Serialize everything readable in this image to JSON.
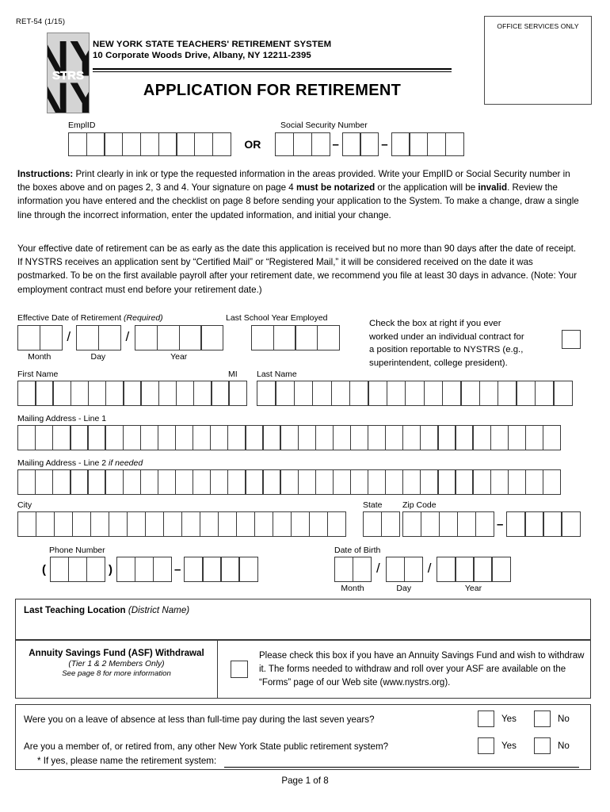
{
  "form": {
    "code": "RET-54  (1/15)",
    "office_box_title": "OFFICE SERVICES ONLY",
    "org_line1": "NEW YORK STATE TEACHERS' RETIREMENT SYSTEM",
    "org_line2": "10 Corporate Woods Drive, Albany, NY 12211-2395",
    "title": "APPLICATION FOR RETIREMENT",
    "logo_text_top": "NY",
    "logo_text_mid": "STRS",
    "logo_text_bottom": "NY"
  },
  "identifiers": {
    "emplid_label": "EmplID",
    "emplid_boxes": 9,
    "or_label": "OR",
    "ssn_label": "Social Security Number",
    "ssn_groups": [
      3,
      2,
      4
    ],
    "ssn_separator": "–"
  },
  "instructions": {
    "heading": "Instructions:",
    "body_1": "Print clearly in ink or type the requested information in the areas provided. Write your EmplID or Social Security number in the boxes above and on pages 2, 3 and 4. Your signature on page 4 ",
    "bold_1": "must be notarized",
    "body_2": " or the application will be ",
    "bold_2": "invalid",
    "body_3": ". Review the information you have entered and the checklist on page 8 before sending your application to the System. To make a change, draw a single line through the incorrect information, enter the updated information, and initial your change.",
    "paragraph_2": "Your effective date of retirement can be as early as the date this application is received but no more than 90 days after the date of receipt. If NYSTRS receives an application sent by “Certified Mail” or “Registered Mail,” it will be considered received on the date it was postmarked. To be on the first available payroll after your retirement date, we recommend you file at least 30 days in advance. (Note: Your employment contract must end before your retirement date.)"
  },
  "retirement_date": {
    "label": "Effective Date of Retirement",
    "label_note": "(Required)",
    "month_label": "Month",
    "day_label": "Day",
    "year_label": "Year",
    "month_boxes": 2,
    "day_boxes": 2,
    "year_boxes": 4,
    "slash": "/"
  },
  "last_school_year": {
    "label": "Last School Year Employed",
    "boxes": 4
  },
  "contract_check": {
    "line1": "Check the box at right if you ever",
    "line2": "worked under an individual contract for",
    "line3": "a position reportable to NYSTRS (e.g.,",
    "line4": "superintendent, college president)."
  },
  "name_fields": {
    "first_label": "First Name",
    "first_boxes": 12,
    "mi_label": "MI",
    "mi_boxes": 1,
    "last_label": "Last Name",
    "last_boxes": 17
  },
  "address": {
    "line1_label": "Mailing Address - Line 1",
    "line1_boxes": 31,
    "line2_label": "Mailing Address - Line 2",
    "line2_note": "if needed",
    "line2_boxes": 31,
    "city_label": "City",
    "city_boxes": 18,
    "state_label": "State",
    "state_boxes": 2,
    "zip_label": "Zip Code",
    "zip_boxes": 5,
    "zip_ext_boxes": 4,
    "zip_separator": "–"
  },
  "phone": {
    "label": "Phone Number",
    "area_boxes": 3,
    "prefix_boxes": 3,
    "line_boxes": 4,
    "open_paren": "(",
    "close_paren": ")",
    "dash": "–"
  },
  "birth": {
    "label": "Date of Birth",
    "month_label": "Month",
    "day_label": "Day",
    "year_label": "Year",
    "month_boxes": 2,
    "day_boxes": 2,
    "year_boxes": 4,
    "slash": "/"
  },
  "teaching_location": {
    "heading": "Last Teaching Location",
    "heading_note": "(District Name)"
  },
  "asf": {
    "heading": "Annuity Savings Fund (ASF) Withdrawal",
    "sub1": "(Tier 1 & 2 Members Only)",
    "sub2": "See page 8 for more information",
    "body": "Please check this box if you have an Annuity Savings Fund and wish to withdraw it. The forms needed to withdraw and roll over your ASF are available on the “Forms” page of our Web site (www.nystrs.org)."
  },
  "questions": {
    "q1": "Were you on a leave of absence at less than full-time pay during the last seven years?",
    "q2": "Are you a member of, or retired from, any other New York State public retirement system?",
    "q2_followup": "* If yes, please name the retirement system:",
    "yes_label": "Yes",
    "no_label": "No"
  },
  "footer": {
    "page_label": "Page 1 of  8"
  },
  "colors": {
    "logo_bg": "#d4d4d4",
    "box_border": "#3a3a3a",
    "text": "#000000"
  }
}
